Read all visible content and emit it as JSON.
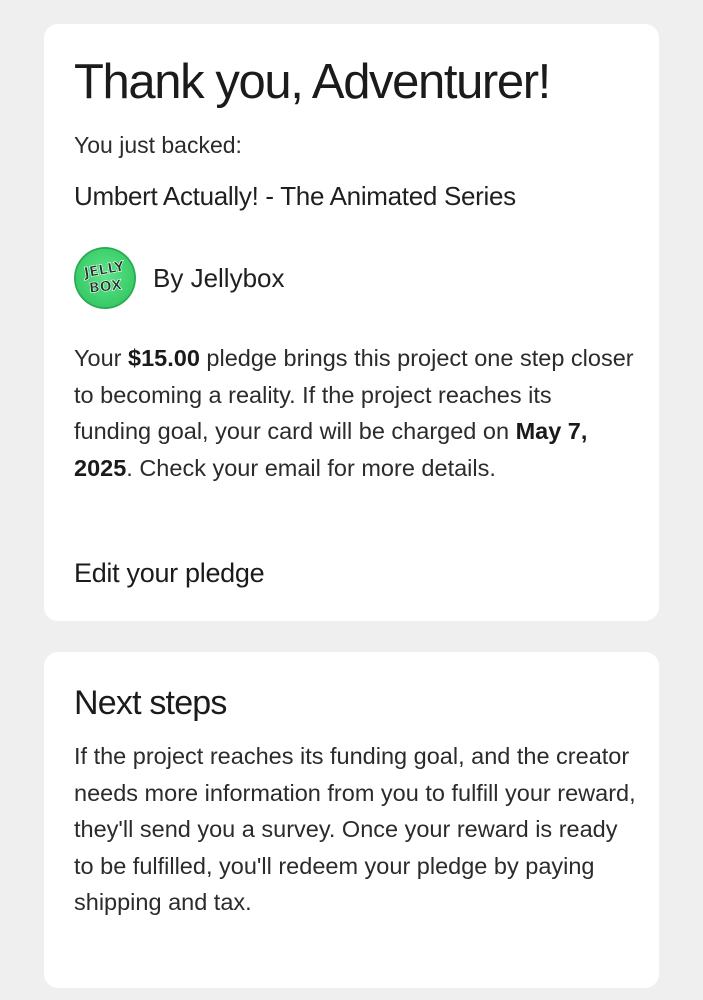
{
  "thanks_card": {
    "title": "Thank you, Adventurer!",
    "backed_label": "You just backed:",
    "project_name": "Umbert Actually! - The Animated Series",
    "creator": {
      "name": "By Jellybox",
      "logo_text": "JELLY BOX",
      "logo_color": "#3fd06d"
    },
    "pledge": {
      "part1": "Your ",
      "amount": "$15.00",
      "part2": " pledge brings this project one step closer to becoming a reality. If the project reaches its funding goal, your card will be charged on ",
      "charge_date": "May 7, 2025",
      "part3": ". Check your email for more details."
    },
    "edit_link": "Edit your pledge"
  },
  "next_steps_card": {
    "title": "Next steps",
    "body": "If the project reaches its funding goal, and the creator needs more information from you to fulfill your reward, they'll send you a survey. Once your reward is ready to be fulfilled, you'll redeem your pledge by paying shipping and tax."
  }
}
